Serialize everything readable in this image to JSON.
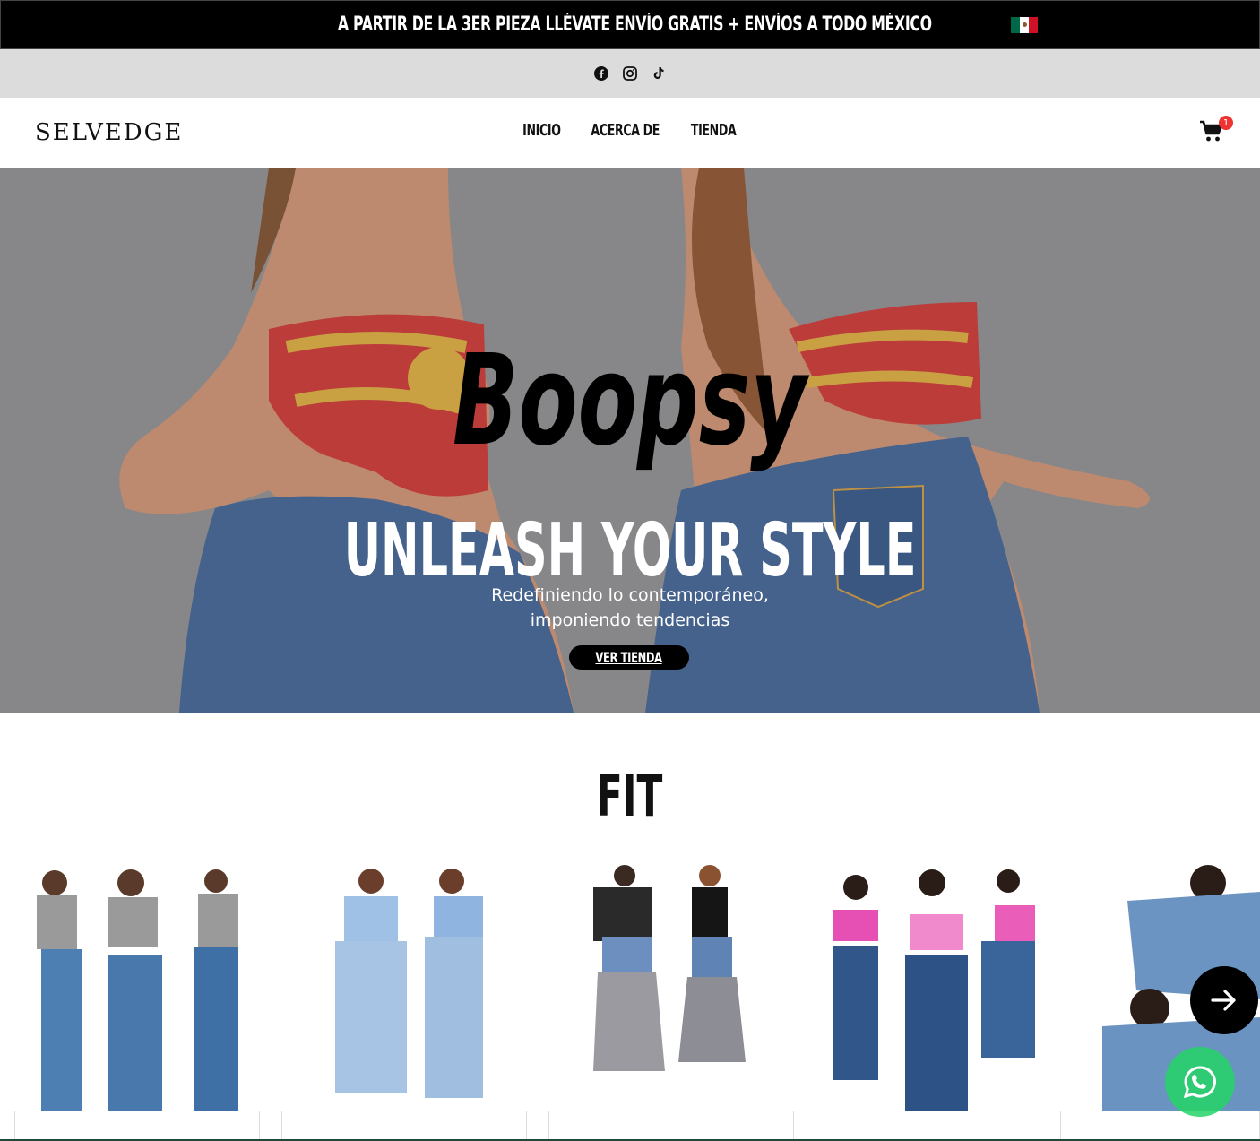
{
  "announcement": {
    "text": "A PARTIR DE LA 3ER PIEZA LLÉVATE ENVÍO GRATIS + ENVÍOS A TODO MÉXICO",
    "flag": "mexico-flag"
  },
  "social": {
    "icons": [
      "facebook-icon",
      "instagram-icon",
      "tiktok-icon"
    ]
  },
  "header": {
    "logo": "SELVEDGE",
    "nav": [
      {
        "label": "INICIO"
      },
      {
        "label": "ACERCA DE"
      },
      {
        "label": "TIENDA"
      }
    ],
    "cart_count": "1"
  },
  "hero": {
    "brand": "Boopsy",
    "title": "UNLEASH YOUR STYLE",
    "subtitle_line1": "Redefiniendo lo contemporáneo,",
    "subtitle_line2": "imponiendo tendencias",
    "button": "VER TIENDA"
  },
  "fit": {
    "title": "FIT"
  },
  "colors": {
    "accent": "#000000",
    "badge": "#e33333",
    "whatsapp": "#25d366",
    "hero_bg": "#8a8a8c"
  }
}
